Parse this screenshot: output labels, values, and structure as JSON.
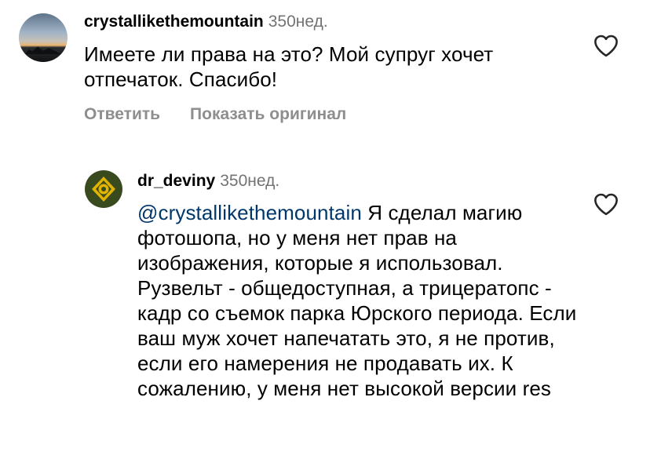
{
  "comments": [
    {
      "username": "crystallikethemountain",
      "age": "350нед.",
      "text": "Имеете ли права на это? Мой супруг хочет отпечаток. Спасибо!",
      "actions": {
        "reply": "Ответить",
        "show_original": "Показать оригинал"
      },
      "avatar_icon": "mountain-sunset-avatar",
      "like_icon": "heart-outline-icon"
    },
    {
      "username": "dr_deviny",
      "age": "350нед.",
      "mention": "@crystallikethemountain",
      "text": " Я сделал магию фотошопа, но у меня нет прав на изображения, которые я использовал. Рузвельт - общедоступная, а трицератопс - кадр со съемок парка Юрского периода. Если ваш муж хочет напечатать это, я не против, если его намерения не продавать их. К сожалению, у меня нет высокой версии res",
      "avatar_icon": "dd-logo-avatar",
      "like_icon": "heart-outline-icon"
    }
  ],
  "colors": {
    "text": "#000000",
    "secondary": "#737373",
    "action": "#8e8e8e",
    "mention": "#00376b"
  }
}
